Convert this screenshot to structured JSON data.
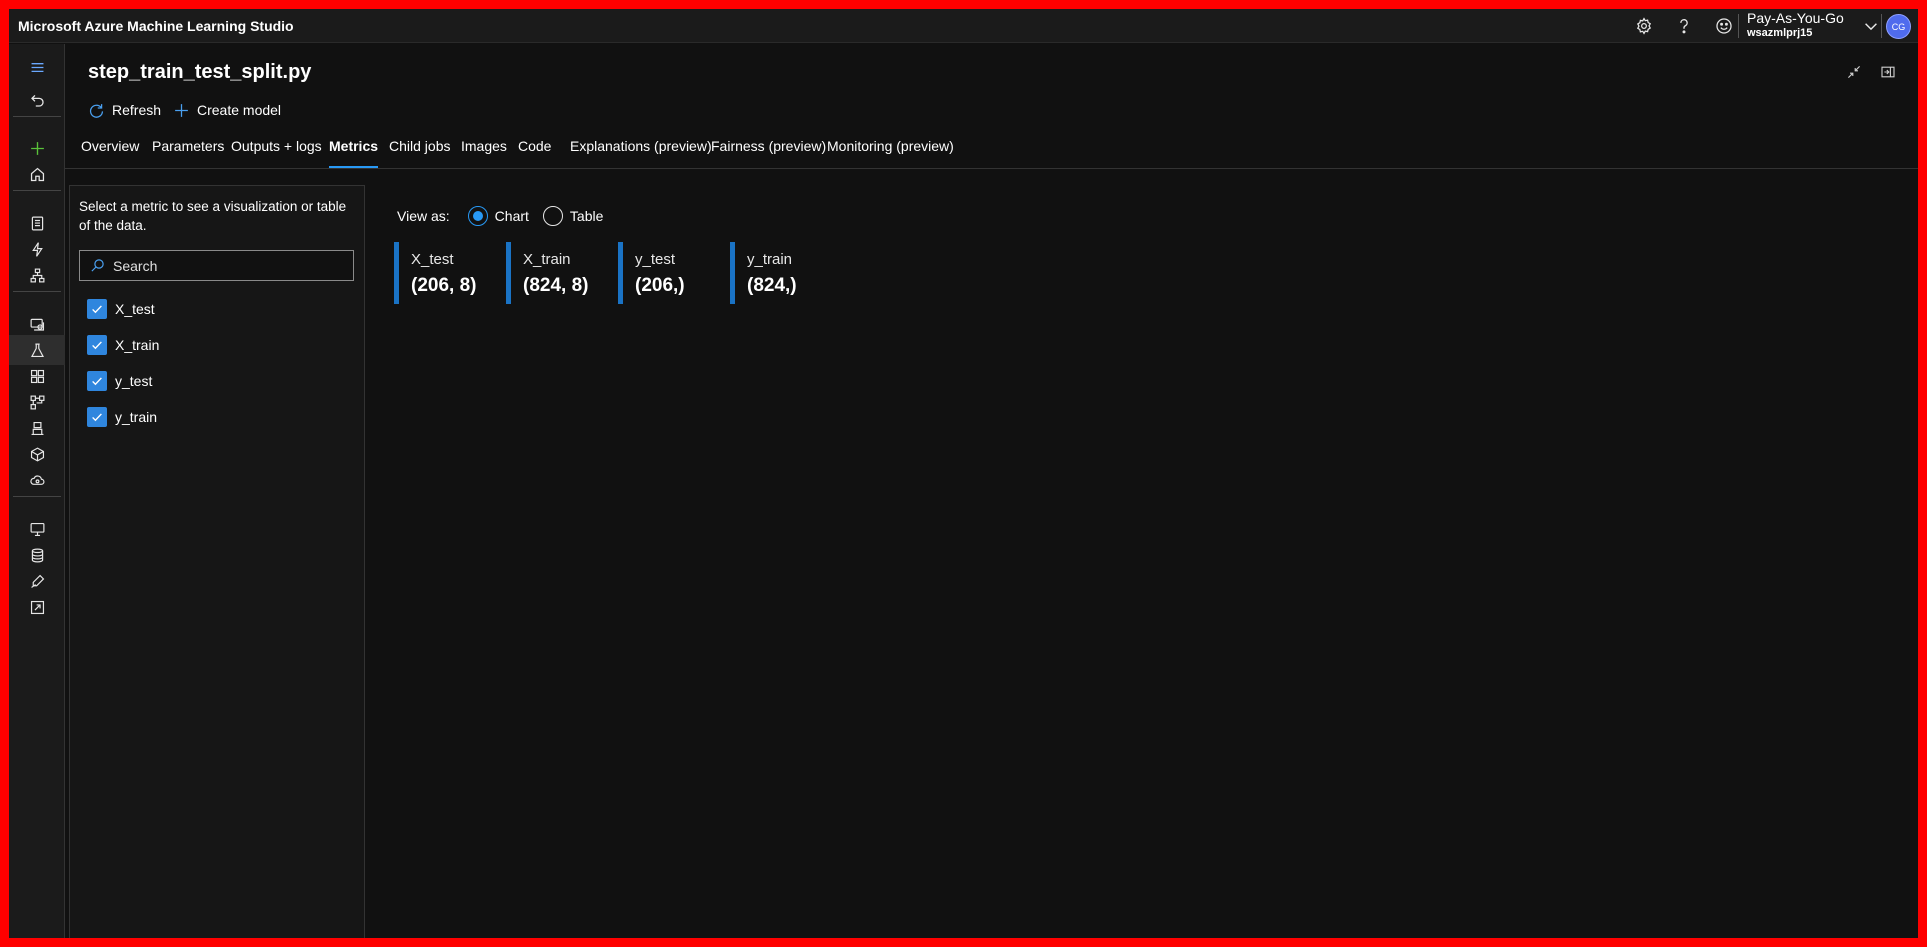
{
  "app": {
    "title": "Microsoft Azure Machine Learning Studio"
  },
  "topbar": {
    "subscription": "Pay-As-You-Go",
    "workspace": "wsazmlprj15",
    "avatar_initials": "CG",
    "icons": [
      "settings-icon",
      "help-icon",
      "feedback-smiley-icon",
      "chevron-down-icon"
    ]
  },
  "leftnav": {
    "icons": [
      "hamburger-menu-icon",
      "back-icon",
      "new-plus-icon",
      "home-icon",
      "notebooks-icon",
      "automl-icon",
      "designer-icon",
      "data-icon",
      "jobs-icon",
      "components-icon",
      "pipelines-icon",
      "environments-icon",
      "models-icon",
      "endpoints-icon",
      "compute-icon",
      "datastores-icon",
      "data-labeling-icon",
      "linked-services-icon"
    ],
    "active": "jobs-icon"
  },
  "header": {
    "title": "step_train_test_split.py",
    "refresh_label": "Refresh",
    "create_model_label": "Create model"
  },
  "tabs": [
    {
      "label": "Overview"
    },
    {
      "label": "Parameters"
    },
    {
      "label": "Outputs + logs"
    },
    {
      "label": "Metrics",
      "active": true
    },
    {
      "label": "Child jobs"
    },
    {
      "label": "Images"
    },
    {
      "label": "Code"
    },
    {
      "label": "Explanations (preview)"
    },
    {
      "label": "Fairness (preview)"
    },
    {
      "label": "Monitoring (preview)"
    }
  ],
  "panel": {
    "description": "Select a metric to see a visualization or table of the data.",
    "search_placeholder": "Search",
    "metrics": [
      {
        "label": "X_test",
        "checked": true
      },
      {
        "label": "X_train",
        "checked": true
      },
      {
        "label": "y_test",
        "checked": true
      },
      {
        "label": "y_train",
        "checked": true
      }
    ]
  },
  "view": {
    "label": "View as:",
    "options": [
      {
        "label": "Chart",
        "selected": true
      },
      {
        "label": "Table",
        "selected": false
      }
    ]
  },
  "tiles": [
    {
      "name": "X_test",
      "value": "(206, 8)"
    },
    {
      "name": "X_train",
      "value": "(824, 8)"
    },
    {
      "name": "y_test",
      "value": "(206,)"
    },
    {
      "name": "y_train",
      "value": "(824,)"
    }
  ],
  "colors": {
    "accent": "#2899f5",
    "tile_bar": "#1a73c5",
    "checkbox": "#2f86de",
    "background": "#111111",
    "frame_border": "#ff0000"
  }
}
